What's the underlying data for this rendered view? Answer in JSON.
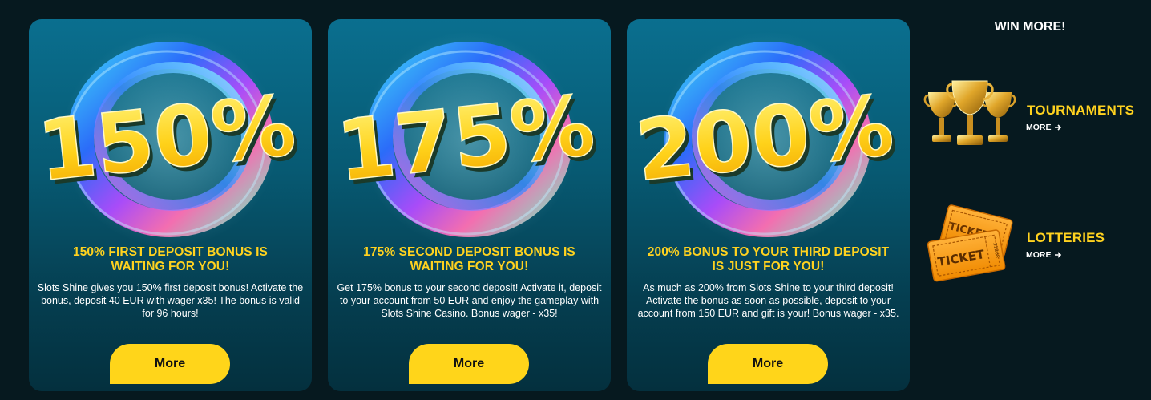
{
  "colors": {
    "background": "#06191f",
    "card_top": "#0a6f8f",
    "card_bottom": "#04303e",
    "accent_yellow": "#ffd51a",
    "text_white": "#ffffff"
  },
  "cards": [
    {
      "percent": "150%",
      "title": "150% FIRST DEPOSIT BONUS IS WAITING FOR YOU!",
      "description": "Slots Shine gives you 150% first deposit bonus! Activate the bonus, deposit 40 EUR with wager x35! The bonus is valid for 96 hours!",
      "button_label": "More",
      "icon": "rainbow-swirl-icon"
    },
    {
      "percent": "175%",
      "title": "175% SECOND DEPOSIT BONUS IS WAITING FOR YOU!",
      "description": "Get 175% bonus to your second deposit! Activate it, deposit to your account from 50 EUR and enjoy the gameplay with Slots Shine Casino. Bonus wager - x35!",
      "button_label": "More",
      "icon": "rainbow-swirl-icon"
    },
    {
      "percent": "200%",
      "title": "200% BONUS TO YOUR THIRD DEPOSIT IS JUST FOR YOU!",
      "description": "As much as 200% from Slots Shine to your third deposit! Activate the bonus as soon as possible, deposit to your account from 150 EUR and gift is your! Bonus wager - x35.",
      "button_label": "More",
      "icon": "rainbow-swirl-icon"
    }
  ],
  "sidebar": {
    "heading": "WIN MORE!",
    "items": [
      {
        "label": "TOURNAMENTS",
        "more_label": "MORE",
        "icon": "trophies-icon"
      },
      {
        "label": "LOTTERIES",
        "more_label": "MORE",
        "icon": "tickets-icon",
        "ticket_text": "TICKET",
        "ticket_serial": "31268"
      }
    ]
  }
}
